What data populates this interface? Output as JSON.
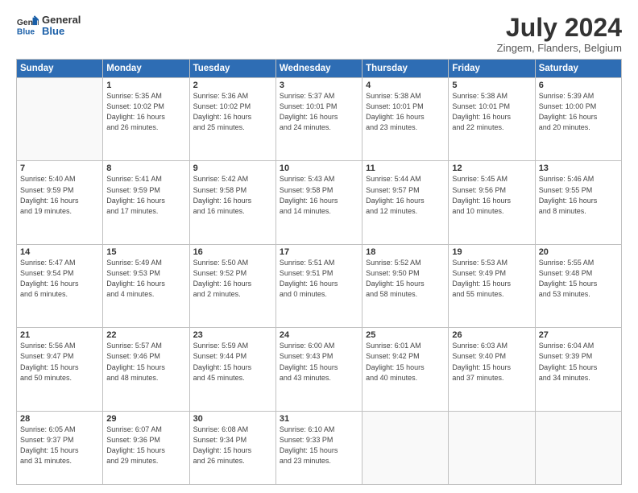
{
  "logo": {
    "line1": "General",
    "line2": "Blue"
  },
  "title": "July 2024",
  "subtitle": "Zingem, Flanders, Belgium",
  "days_of_week": [
    "Sunday",
    "Monday",
    "Tuesday",
    "Wednesday",
    "Thursday",
    "Friday",
    "Saturday"
  ],
  "weeks": [
    [
      {
        "day": "",
        "info": ""
      },
      {
        "day": "1",
        "info": "Sunrise: 5:35 AM\nSunset: 10:02 PM\nDaylight: 16 hours\nand 26 minutes."
      },
      {
        "day": "2",
        "info": "Sunrise: 5:36 AM\nSunset: 10:02 PM\nDaylight: 16 hours\nand 25 minutes."
      },
      {
        "day": "3",
        "info": "Sunrise: 5:37 AM\nSunset: 10:01 PM\nDaylight: 16 hours\nand 24 minutes."
      },
      {
        "day": "4",
        "info": "Sunrise: 5:38 AM\nSunset: 10:01 PM\nDaylight: 16 hours\nand 23 minutes."
      },
      {
        "day": "5",
        "info": "Sunrise: 5:38 AM\nSunset: 10:01 PM\nDaylight: 16 hours\nand 22 minutes."
      },
      {
        "day": "6",
        "info": "Sunrise: 5:39 AM\nSunset: 10:00 PM\nDaylight: 16 hours\nand 20 minutes."
      }
    ],
    [
      {
        "day": "7",
        "info": "Sunrise: 5:40 AM\nSunset: 9:59 PM\nDaylight: 16 hours\nand 19 minutes."
      },
      {
        "day": "8",
        "info": "Sunrise: 5:41 AM\nSunset: 9:59 PM\nDaylight: 16 hours\nand 17 minutes."
      },
      {
        "day": "9",
        "info": "Sunrise: 5:42 AM\nSunset: 9:58 PM\nDaylight: 16 hours\nand 16 minutes."
      },
      {
        "day": "10",
        "info": "Sunrise: 5:43 AM\nSunset: 9:58 PM\nDaylight: 16 hours\nand 14 minutes."
      },
      {
        "day": "11",
        "info": "Sunrise: 5:44 AM\nSunset: 9:57 PM\nDaylight: 16 hours\nand 12 minutes."
      },
      {
        "day": "12",
        "info": "Sunrise: 5:45 AM\nSunset: 9:56 PM\nDaylight: 16 hours\nand 10 minutes."
      },
      {
        "day": "13",
        "info": "Sunrise: 5:46 AM\nSunset: 9:55 PM\nDaylight: 16 hours\nand 8 minutes."
      }
    ],
    [
      {
        "day": "14",
        "info": "Sunrise: 5:47 AM\nSunset: 9:54 PM\nDaylight: 16 hours\nand 6 minutes."
      },
      {
        "day": "15",
        "info": "Sunrise: 5:49 AM\nSunset: 9:53 PM\nDaylight: 16 hours\nand 4 minutes."
      },
      {
        "day": "16",
        "info": "Sunrise: 5:50 AM\nSunset: 9:52 PM\nDaylight: 16 hours\nand 2 minutes."
      },
      {
        "day": "17",
        "info": "Sunrise: 5:51 AM\nSunset: 9:51 PM\nDaylight: 16 hours\nand 0 minutes."
      },
      {
        "day": "18",
        "info": "Sunrise: 5:52 AM\nSunset: 9:50 PM\nDaylight: 15 hours\nand 58 minutes."
      },
      {
        "day": "19",
        "info": "Sunrise: 5:53 AM\nSunset: 9:49 PM\nDaylight: 15 hours\nand 55 minutes."
      },
      {
        "day": "20",
        "info": "Sunrise: 5:55 AM\nSunset: 9:48 PM\nDaylight: 15 hours\nand 53 minutes."
      }
    ],
    [
      {
        "day": "21",
        "info": "Sunrise: 5:56 AM\nSunset: 9:47 PM\nDaylight: 15 hours\nand 50 minutes."
      },
      {
        "day": "22",
        "info": "Sunrise: 5:57 AM\nSunset: 9:46 PM\nDaylight: 15 hours\nand 48 minutes."
      },
      {
        "day": "23",
        "info": "Sunrise: 5:59 AM\nSunset: 9:44 PM\nDaylight: 15 hours\nand 45 minutes."
      },
      {
        "day": "24",
        "info": "Sunrise: 6:00 AM\nSunset: 9:43 PM\nDaylight: 15 hours\nand 43 minutes."
      },
      {
        "day": "25",
        "info": "Sunrise: 6:01 AM\nSunset: 9:42 PM\nDaylight: 15 hours\nand 40 minutes."
      },
      {
        "day": "26",
        "info": "Sunrise: 6:03 AM\nSunset: 9:40 PM\nDaylight: 15 hours\nand 37 minutes."
      },
      {
        "day": "27",
        "info": "Sunrise: 6:04 AM\nSunset: 9:39 PM\nDaylight: 15 hours\nand 34 minutes."
      }
    ],
    [
      {
        "day": "28",
        "info": "Sunrise: 6:05 AM\nSunset: 9:37 PM\nDaylight: 15 hours\nand 31 minutes."
      },
      {
        "day": "29",
        "info": "Sunrise: 6:07 AM\nSunset: 9:36 PM\nDaylight: 15 hours\nand 29 minutes."
      },
      {
        "day": "30",
        "info": "Sunrise: 6:08 AM\nSunset: 9:34 PM\nDaylight: 15 hours\nand 26 minutes."
      },
      {
        "day": "31",
        "info": "Sunrise: 6:10 AM\nSunset: 9:33 PM\nDaylight: 15 hours\nand 23 minutes."
      },
      {
        "day": "",
        "info": ""
      },
      {
        "day": "",
        "info": ""
      },
      {
        "day": "",
        "info": ""
      }
    ]
  ]
}
